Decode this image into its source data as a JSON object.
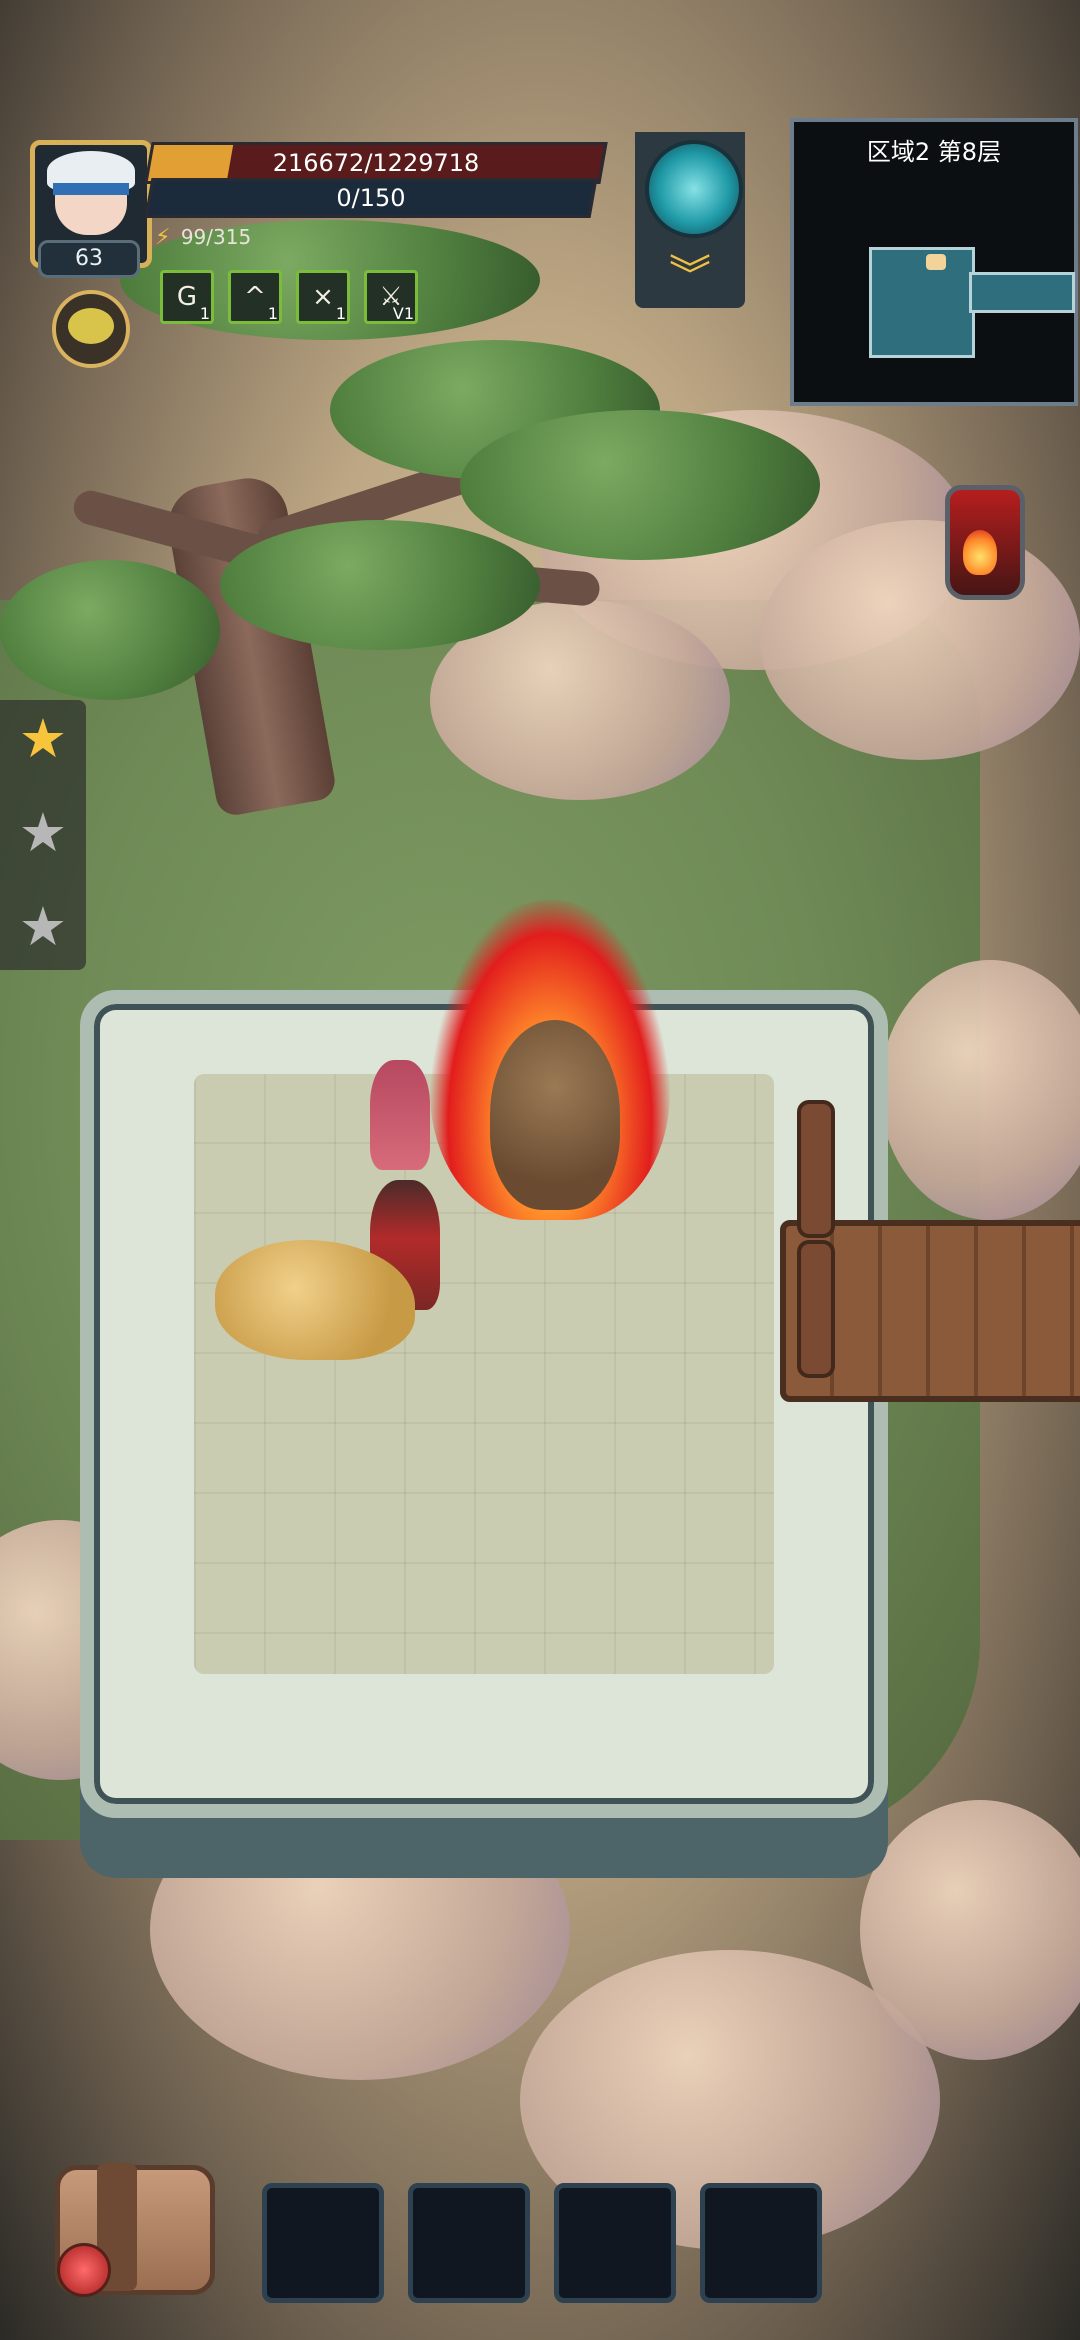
{
  "hud": {
    "level": "63",
    "hp_text": "216672/1229718",
    "hp_fraction": 0.176,
    "xp_text": "0/150",
    "energy_text": "99/315",
    "buffs": [
      {
        "name": "frost-rune",
        "symbol": "G",
        "count": "1"
      },
      {
        "name": "power-up",
        "symbol": "^",
        "count": "1"
      },
      {
        "name": "crossed-swords",
        "symbol": "⨯",
        "count": "1"
      },
      {
        "name": "slash-skill",
        "symbol": "⚔",
        "count": "1"
      }
    ],
    "buff_labels": {
      "fourth_count": "V1"
    }
  },
  "minimap": {
    "title": "区域2 第8层"
  },
  "stars": {
    "filled": 1,
    "total": 3
  },
  "inventory": {
    "slots": 4
  },
  "colors": {
    "hp_fill": "#e2a034",
    "hp_bg": "#5a1b1c",
    "xp_bg": "#1c2b3b",
    "star_gold": "#f7c43c",
    "star_grey": "#b7b7b7",
    "accent_teal": "#1f9aa7"
  }
}
